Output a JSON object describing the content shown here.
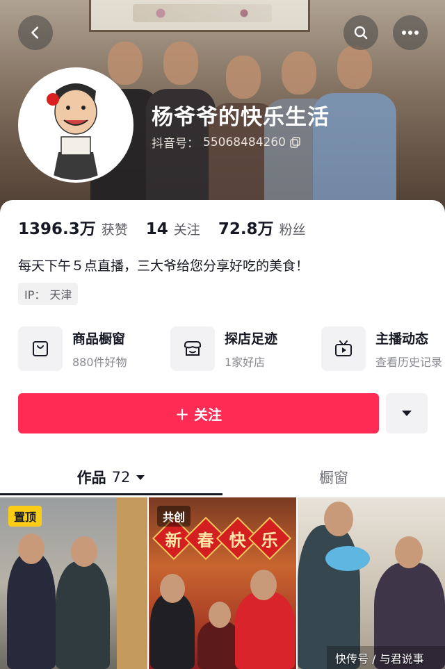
{
  "profile": {
    "name": "杨爷爷的快乐生活",
    "douyin_id_label": "抖音号：",
    "douyin_id": "55068484260"
  },
  "stats": [
    {
      "value": "1396.3万",
      "label": "获赞"
    },
    {
      "value": "14",
      "label": "关注"
    },
    {
      "value": "72.8万",
      "label": "粉丝"
    }
  ],
  "bio": "每天下午５点直播，三大爷给您分享好吃的美食！",
  "ip": {
    "label": "IP：",
    "value": "天津"
  },
  "features": [
    {
      "title": "商品橱窗",
      "subtitle": "880件好物",
      "icon": "shopping-bag-icon"
    },
    {
      "title": "探店足迹",
      "subtitle": "1家好店",
      "icon": "store-icon"
    },
    {
      "title": "主播动态",
      "subtitle": "查看历史记录",
      "icon": "tv-icon"
    }
  ],
  "actions": {
    "follow_label": "＋ 关注"
  },
  "tabs": {
    "works_label": "作品",
    "works_count": "72",
    "shop_label": "橱窗"
  },
  "videos": [
    {
      "badge": "置顶",
      "icon": "pinned"
    },
    {
      "badge": "共创",
      "banner": [
        "新",
        "春",
        "快",
        "乐"
      ]
    },
    {
      "badge": ""
    }
  ],
  "watermark": "快传号 / 与君说事",
  "colors": {
    "follow": "#fe2c55",
    "pinned_badge": "#facc15",
    "text_primary": "#161823",
    "text_secondary": "#8a8b91"
  }
}
